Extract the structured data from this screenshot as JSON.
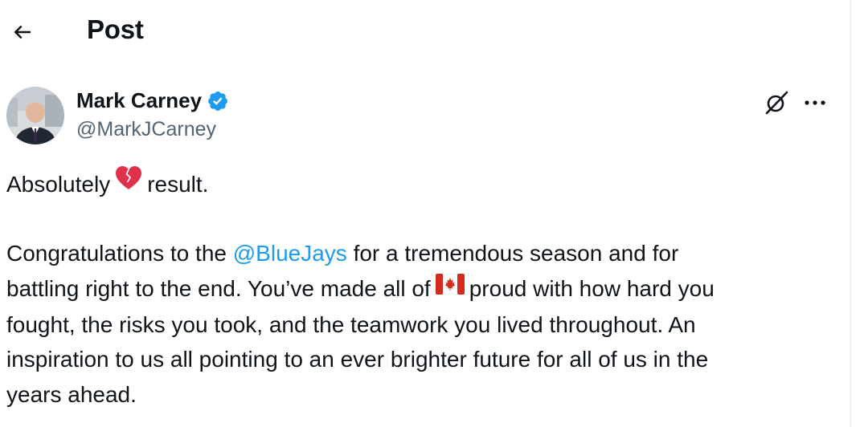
{
  "header": {
    "title": "Post",
    "back_icon": "arrow-left-icon"
  },
  "author": {
    "name": "Mark Carney",
    "handle": "@MarkJCarney",
    "verified_icon": "verified-badge-icon",
    "verified_color": "#1d9bf0"
  },
  "actions": {
    "grok_icon": "grok-icon",
    "more_icon": "more-horizontal-icon"
  },
  "post": {
    "line1": {
      "before": "Absolutely",
      "emoji": "broken-heart-icon",
      "after": "result."
    },
    "para2": {
      "l1_before": "Congratulations to the ",
      "mention": "@BlueJays",
      "l1_after": " for a tremendous season and for",
      "l2_before": "battling right to the end. You’ve made all of",
      "flag_emoji": "canada-flag-icon",
      "l2_after": "proud with how hard you",
      "l3": "fought, the risks you took, and the teamwork you lived throughout. An",
      "l4": "inspiration to us all pointing to an ever brighter future for all of us in the",
      "l5": "years ahead."
    }
  },
  "colors": {
    "text": "#0f1419",
    "secondary": "#536471",
    "accent": "#1d9bf0",
    "broken_heart": "#e0314b",
    "flag_red": "#d52b1e"
  }
}
